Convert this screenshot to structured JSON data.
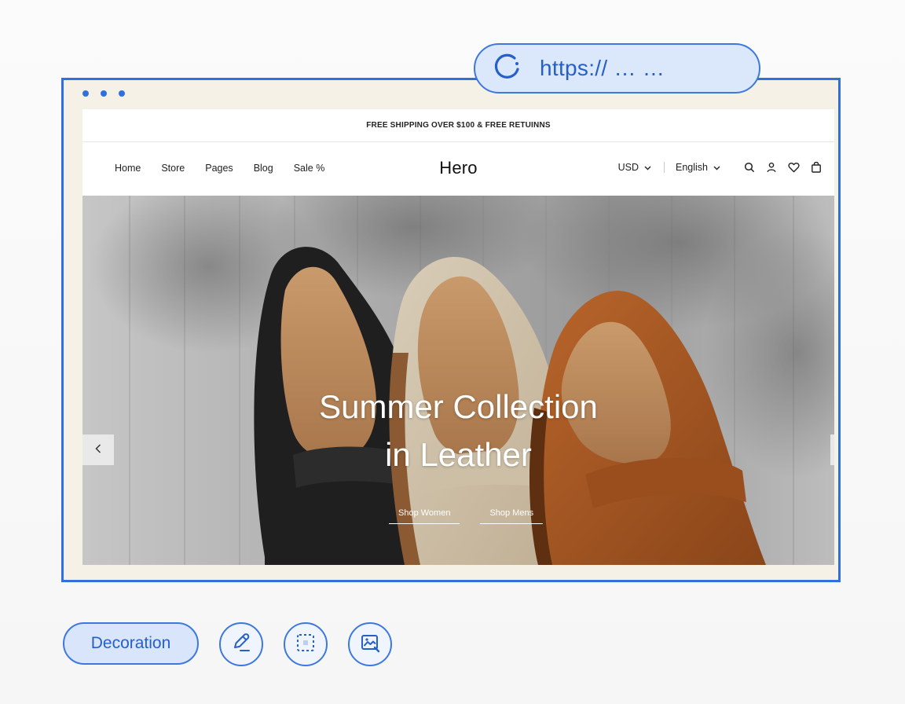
{
  "address_bar": {
    "url": "https:// … …",
    "status_icon": "loading-spinner-icon"
  },
  "window": {
    "controls": [
      "window-dot-1",
      "window-dot-2",
      "window-dot-3"
    ]
  },
  "site": {
    "announcement": "FREE SHIPPING OVER $100 & FREE RETUINNS",
    "brand": "Hero",
    "nav": [
      {
        "label": "Home"
      },
      {
        "label": "Store"
      },
      {
        "label": "Pages"
      },
      {
        "label": "Blog"
      },
      {
        "label": "Sale %"
      }
    ],
    "currency": "USD",
    "language": "English",
    "icons": [
      "search-icon",
      "account-icon",
      "wishlist-icon",
      "cart-icon"
    ]
  },
  "hero": {
    "title_line1": "Summer Collection",
    "title_line2": "in Leather",
    "cta_primary": "Shop Women",
    "cta_secondary": "Shop Mens",
    "prev_icon": "chevron-left-icon"
  },
  "toolbar": {
    "decoration_label": "Decoration",
    "tools": [
      "edit-pen-icon",
      "select-area-icon",
      "image-edit-icon"
    ]
  },
  "colors": {
    "accent": "#2f6fde",
    "accent_light": "#d8e5fb",
    "page_bg": "#f5f1e7"
  }
}
